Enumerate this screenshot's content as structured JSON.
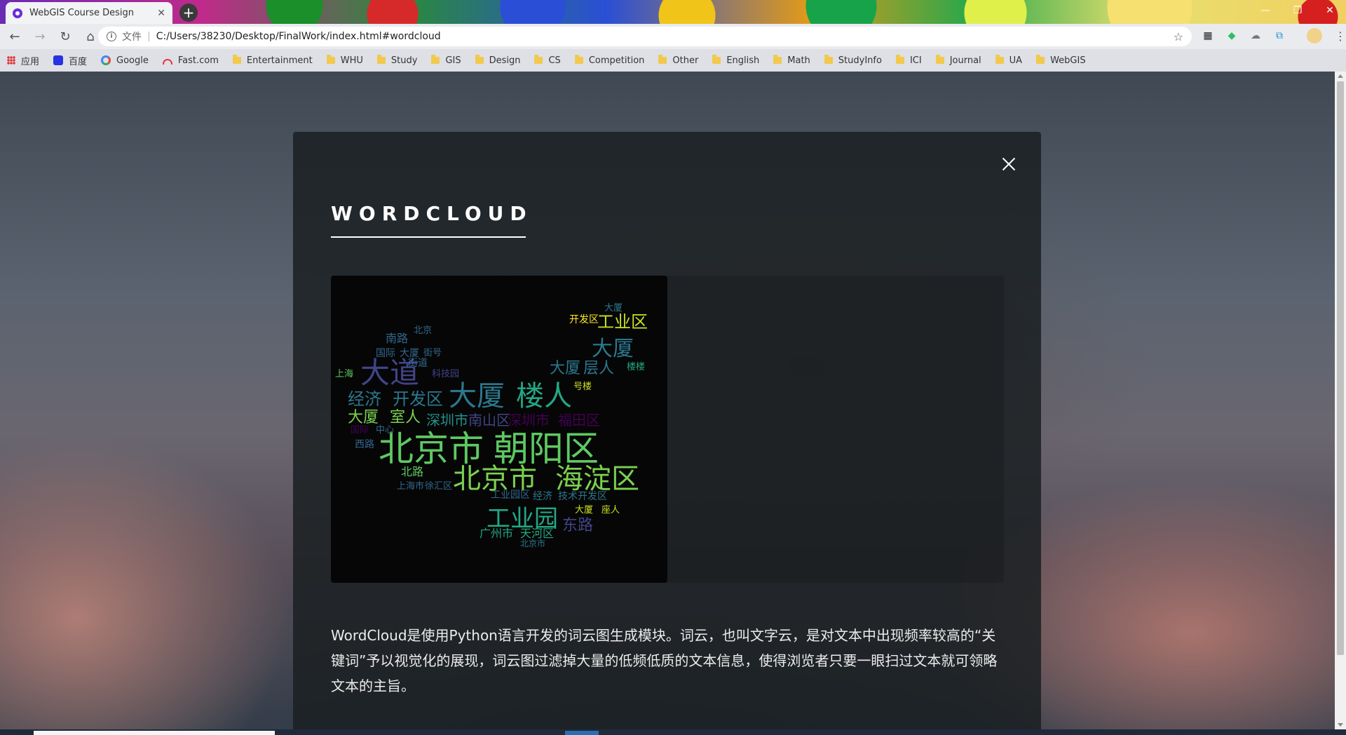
{
  "browser": {
    "tab_title": "WebGIS Course Design",
    "tab_close": "✕",
    "new_tab": "+",
    "window_controls": [
      "—",
      "❐",
      "✕"
    ],
    "omnibox": {
      "scheme_label": "文件",
      "separator": "|",
      "url": "C:/Users/38230/Desktop/FinalWork/index.html#wordcloud"
    },
    "nav": {
      "back": "←",
      "forward": "→",
      "reload": "↻",
      "home": "⌂"
    },
    "bookmarks": [
      {
        "label": "应用",
        "icon": "apps-icon"
      },
      {
        "label": "百度",
        "icon": "baidu-icon"
      },
      {
        "label": "Google",
        "icon": "google-icon"
      },
      {
        "label": "Fast.com",
        "icon": "fast-icon"
      },
      {
        "label": "Entertainment",
        "icon": "folder-icon"
      },
      {
        "label": "WHU",
        "icon": "folder-icon"
      },
      {
        "label": "Study",
        "icon": "folder-icon"
      },
      {
        "label": "GIS",
        "icon": "folder-icon"
      },
      {
        "label": "Design",
        "icon": "folder-icon"
      },
      {
        "label": "CS",
        "icon": "folder-icon"
      },
      {
        "label": "Competition",
        "icon": "folder-icon"
      },
      {
        "label": "Other",
        "icon": "folder-icon"
      },
      {
        "label": "English",
        "icon": "folder-icon"
      },
      {
        "label": "Math",
        "icon": "folder-icon"
      },
      {
        "label": "StudyInfo",
        "icon": "folder-icon"
      },
      {
        "label": "ICI",
        "icon": "folder-icon"
      },
      {
        "label": "Journal",
        "icon": "folder-icon"
      },
      {
        "label": "UA",
        "icon": "folder-icon"
      },
      {
        "label": "WebGIS",
        "icon": "folder-icon"
      }
    ]
  },
  "modal": {
    "title": "WORDCLOUD",
    "description": "WordCloud是使用Python语言开发的词云图生成模块。词云，也叫文字云，是对文本中出现频率较高的“关键词”予以视觉化的展现，词云图过滤掉大量的低频低质的文本信息，使得浏览者只要一眼扫过文本就可领略文本的主旨。"
  },
  "wordcloud": {
    "words": [
      {
        "text": "北京市",
        "color": "#5ec962"
      },
      {
        "text": "朝阳区",
        "color": "#5ec962"
      },
      {
        "text": "北京市",
        "color": "#7ad151"
      },
      {
        "text": "海淀区",
        "color": "#7ad151"
      },
      {
        "text": "大厦",
        "color": "#2a788e"
      },
      {
        "text": "楼人",
        "color": "#22a884"
      },
      {
        "text": "大道",
        "color": "#414487"
      },
      {
        "text": "工业园",
        "color": "#22a884"
      },
      {
        "text": "工业区",
        "color": "#c8e020"
      },
      {
        "text": "大厦",
        "color": "#2a788e"
      },
      {
        "text": "经济",
        "color": "#2a788e"
      },
      {
        "text": "开发区",
        "color": "#2a788e"
      },
      {
        "text": "大厦",
        "color": "#7ad151"
      },
      {
        "text": "室人",
        "color": "#7ad151"
      },
      {
        "text": "大厦",
        "color": "#2a788e"
      },
      {
        "text": "层人",
        "color": "#2a788e"
      },
      {
        "text": "深圳市",
        "color": "#21918c"
      },
      {
        "text": "南山区",
        "color": "#414487"
      },
      {
        "text": "深圳市",
        "color": "#440154"
      },
      {
        "text": "福田区",
        "color": "#440154"
      },
      {
        "text": "广州市",
        "color": "#22a884"
      },
      {
        "text": "天河区",
        "color": "#22a884"
      },
      {
        "text": "东路",
        "color": "#414487"
      },
      {
        "text": "南路",
        "color": "#31688e"
      },
      {
        "text": "国际",
        "color": "#31688e"
      },
      {
        "text": "大厦",
        "color": "#31688e"
      },
      {
        "text": "街道",
        "color": "#31688e"
      },
      {
        "text": "开发区",
        "color": "#fde725"
      },
      {
        "text": "北路",
        "color": "#5ec962"
      },
      {
        "text": "上海市",
        "color": "#31688e"
      },
      {
        "text": "徐汇区",
        "color": "#31688e"
      },
      {
        "text": "经济",
        "color": "#2a788e"
      },
      {
        "text": "技术开发区",
        "color": "#2a788e"
      },
      {
        "text": "大厦",
        "color": "#c8e020"
      },
      {
        "text": "座人",
        "color": "#c8e020"
      },
      {
        "text": "工业园区",
        "color": "#31688e"
      },
      {
        "text": "西路",
        "color": "#31688e"
      },
      {
        "text": "上海",
        "color": "#5ec962"
      },
      {
        "text": "科技园",
        "color": "#414487"
      },
      {
        "text": "号楼",
        "color": "#c8e020"
      },
      {
        "text": "楼楼",
        "color": "#22a884"
      },
      {
        "text": "北京",
        "color": "#31688e"
      },
      {
        "text": "大厦",
        "color": "#2a788e"
      },
      {
        "text": "北京市",
        "color": "#2a788e"
      },
      {
        "text": "国际",
        "color": "#440154"
      },
      {
        "text": "中心",
        "color": "#31688e"
      },
      {
        "text": "街号",
        "color": "#31688e"
      }
    ]
  }
}
